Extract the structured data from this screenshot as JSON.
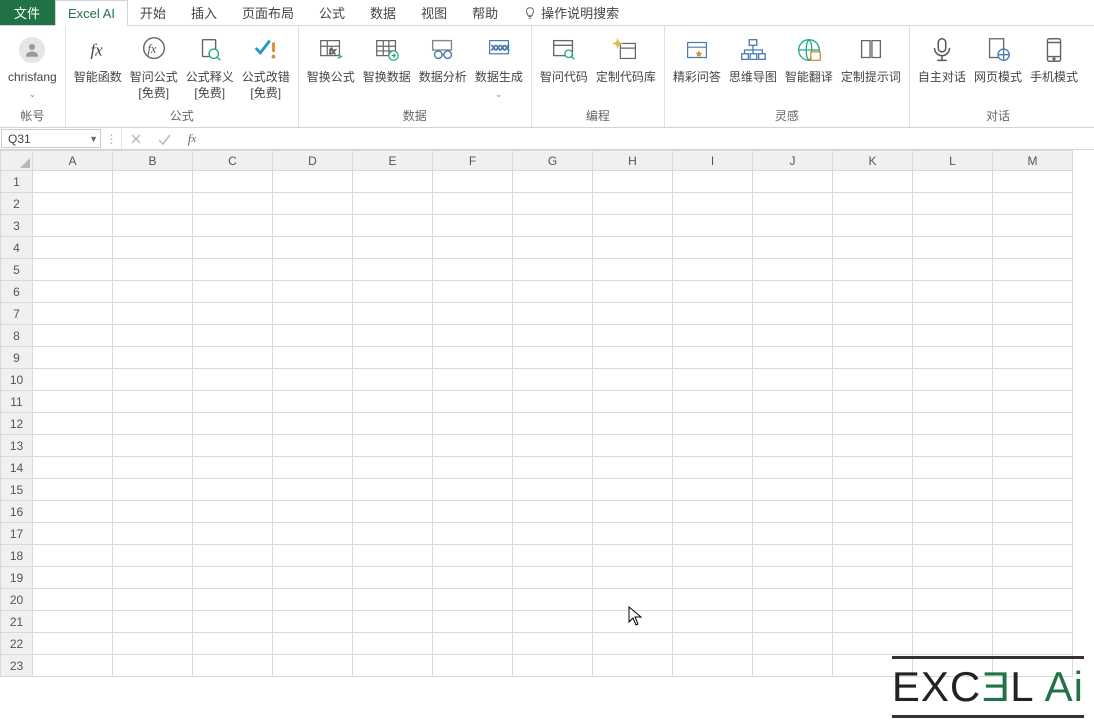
{
  "tabs": {
    "file": "文件",
    "active": "Excel AI",
    "items": [
      "开始",
      "插入",
      "页面布局",
      "公式",
      "数据",
      "视图",
      "帮助"
    ],
    "tell_me": "操作说明搜索"
  },
  "ribbon": {
    "account": {
      "user": "chrisfang",
      "group": "帐号"
    },
    "formula": {
      "group": "公式",
      "smartfn": "智能函数",
      "ask": "智问公式\n[免费]",
      "explain": "公式释义\n[免费]",
      "debug": "公式改错\n[免费]"
    },
    "data": {
      "group": "数据",
      "swapfx": "智换公式",
      "swapdata": "智换数据",
      "analyze": "数据分析",
      "generate": "数据生成"
    },
    "coding": {
      "group": "编程",
      "askcode": "智问代码",
      "codebase": "定制代码库"
    },
    "inspire": {
      "group": "灵感",
      "qa": "精彩问答",
      "mindmap": "思维导图",
      "translate": "智能翻译",
      "prompt": "定制提示词"
    },
    "dialog": {
      "group": "对话",
      "auto": "自主对话",
      "web": "网页模式",
      "mobile": "手机模式"
    }
  },
  "formula_bar": {
    "namebox": "Q31",
    "value": ""
  },
  "grid": {
    "cols": [
      "A",
      "B",
      "C",
      "D",
      "E",
      "F",
      "G",
      "H",
      "I",
      "J",
      "K",
      "L",
      "M"
    ],
    "rows": [
      "1",
      "2",
      "3",
      "4",
      "5",
      "6",
      "7",
      "8",
      "9",
      "10",
      "11",
      "12",
      "13",
      "14",
      "15",
      "16",
      "17",
      "18",
      "19",
      "20",
      "21",
      "22",
      "23"
    ]
  },
  "logo": {
    "part1": "EXC",
    "part2": "E",
    "part3": "L",
    "part4": "A",
    "part5": "i"
  }
}
